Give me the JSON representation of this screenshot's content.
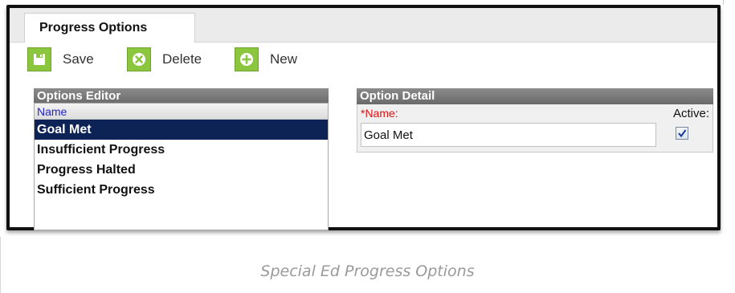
{
  "tab": {
    "label": "Progress Options"
  },
  "toolbar": {
    "save_label": "Save",
    "delete_label": "Delete",
    "new_label": "New"
  },
  "options_editor": {
    "title": "Options Editor",
    "column_header": "Name",
    "items": [
      "Goal Met",
      "Insufficient Progress",
      "Progress Halted",
      "Sufficient Progress"
    ],
    "selected_index": 0
  },
  "option_detail": {
    "title": "Option Detail",
    "name_label": "*Name:",
    "name_value": "Goal Met",
    "active_label": "Active:",
    "active_checked": true
  },
  "caption": "Special Ed Progress Options",
  "colors": {
    "accent_green": "#8cc63f",
    "selected_row": "#0d2356",
    "header_gray": "#7a7a7a",
    "required_red": "#e01010"
  },
  "icons": {
    "save": "floppy-disk-icon",
    "delete": "x-circle-icon",
    "new": "plus-circle-icon",
    "checkbox": "checkmark-icon"
  }
}
